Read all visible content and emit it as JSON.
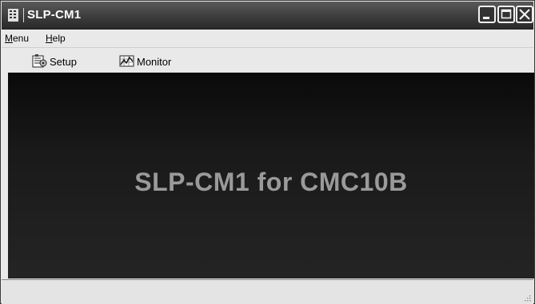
{
  "window": {
    "title": "SLP-CM1",
    "app_icon": "app-icon",
    "controls": [
      "minimize-icon",
      "maximize-icon",
      "close-icon"
    ]
  },
  "menubar": {
    "items": [
      {
        "label": "Menu",
        "underline": "M",
        "rest": "enu"
      },
      {
        "label": "Help",
        "underline": "H",
        "rest": "elp"
      }
    ]
  },
  "toolbar": {
    "setup_label": "Setup",
    "monitor_label": "Monitor",
    "setup_icon": "setup-icon",
    "monitor_icon": "monitor-icon"
  },
  "content": {
    "banner": "SLP-CM1 for CMC10B"
  },
  "statusbar": {
    "text": ""
  }
}
